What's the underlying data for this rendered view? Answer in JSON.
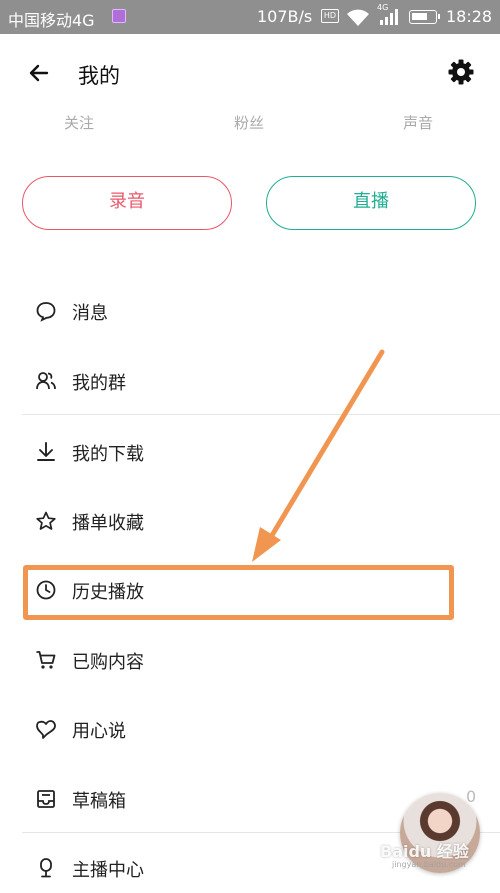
{
  "status_bar": {
    "carrier": "中国移动4G",
    "speed": "107B/s",
    "hd_label": "HD",
    "network_type": "4G",
    "time": "18:28"
  },
  "header": {
    "title": "我的",
    "back_icon": "arrow-left-icon",
    "settings_icon": "gear-icon"
  },
  "stats": [
    {
      "label": "关注"
    },
    {
      "label": "粉丝"
    },
    {
      "label": "声音"
    }
  ],
  "actions": {
    "record_label": "录音",
    "live_label": "直播",
    "record_color": "#e8586b",
    "live_color": "#1fae93"
  },
  "menu": [
    {
      "label": "消息",
      "icon": "message-bubble-icon"
    },
    {
      "label": "我的群",
      "icon": "group-icon"
    },
    {
      "label": "我的下载",
      "icon": "download-icon"
    },
    {
      "label": "播单收藏",
      "icon": "star-icon"
    },
    {
      "label": "历史播放",
      "icon": "clock-icon"
    },
    {
      "label": "已购内容",
      "icon": "cart-icon"
    },
    {
      "label": "用心说",
      "icon": "heart-chat-icon"
    },
    {
      "label": "草稿箱",
      "icon": "inbox-icon"
    },
    {
      "label": "主播中心",
      "icon": "microphone-icon"
    }
  ],
  "draft_count": "0",
  "annotation_color": "#f09650",
  "watermark": {
    "text": "Baidu 经验",
    "sub": "jingyan.baidu.com"
  }
}
